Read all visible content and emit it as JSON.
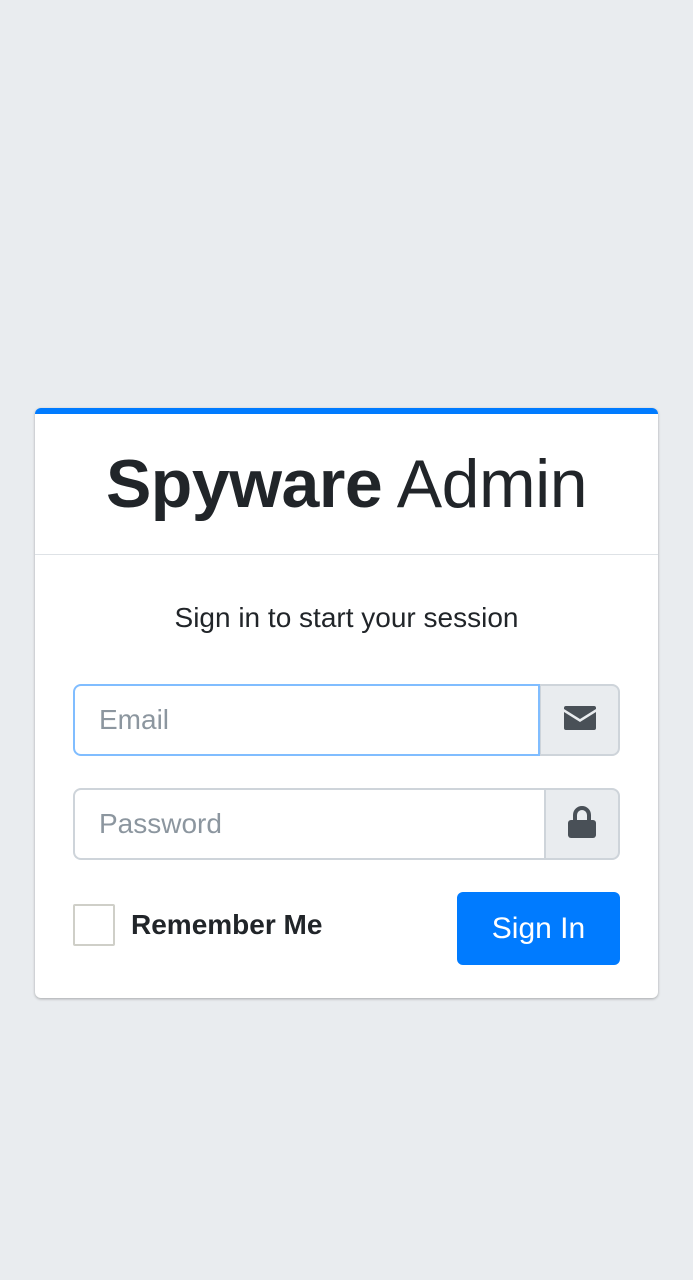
{
  "brand": {
    "bold": "Spyware",
    "light": "Admin"
  },
  "login": {
    "subtitle": "Sign in to start your session",
    "email_placeholder": "Email",
    "password_placeholder": "Password",
    "remember_label": "Remember Me",
    "remember_checked": false,
    "submit_label": "Sign In"
  },
  "icons": {
    "email": "envelope-icon",
    "password": "lock-icon"
  },
  "colors": {
    "accent": "#007bff",
    "background": "#e9ecef",
    "focus_border": "#80bdff"
  }
}
